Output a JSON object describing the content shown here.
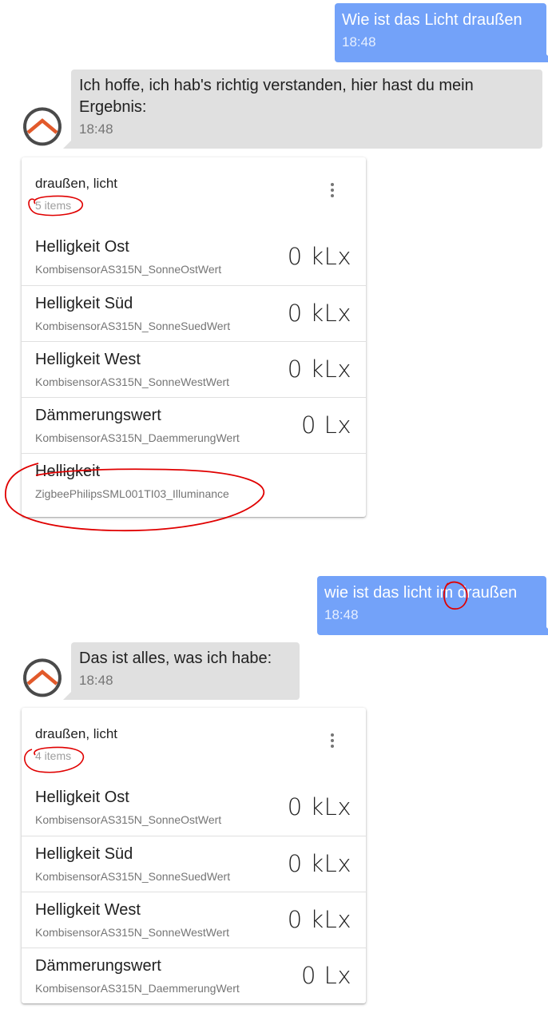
{
  "messages": [
    {
      "role": "user",
      "text": "Wie ist das Licht draußen",
      "time": "18:48"
    },
    {
      "role": "bot",
      "text": "Ich hoffe, ich hab's richtig verstanden, hier hast du mein Ergebnis:",
      "time": "18:48"
    },
    {
      "role": "user",
      "text": "wie ist das licht im draußen",
      "time": "18:48"
    },
    {
      "role": "bot",
      "text": "Das ist alles, was ich habe:",
      "time": "18:48"
    }
  ],
  "card1": {
    "title": "draußen, licht",
    "count": "5 items",
    "items": [
      {
        "label": "Helligkeit Ost",
        "item": "KombisensorAS315N_SonneOstWert",
        "value": "0 kLx"
      },
      {
        "label": "Helligkeit Süd",
        "item": "KombisensorAS315N_SonneSuedWert",
        "value": "0 kLx"
      },
      {
        "label": "Helligkeit West",
        "item": "KombisensorAS315N_SonneWestWert",
        "value": "0 kLx"
      },
      {
        "label": "Dämmerungswert",
        "item": "KombisensorAS315N_DaemmerungWert",
        "value": "0 Lx"
      },
      {
        "label": "Helligkeit",
        "item": "ZigbeePhilipsSML001TI03_Illuminance",
        "value": ""
      }
    ]
  },
  "card2": {
    "title": "draußen, licht",
    "count": "4 items",
    "items": [
      {
        "label": "Helligkeit Ost",
        "item": "KombisensorAS315N_SonneOstWert",
        "value": "0 kLx"
      },
      {
        "label": "Helligkeit Süd",
        "item": "KombisensorAS315N_SonneSuedWert",
        "value": "0 kLx"
      },
      {
        "label": "Helligkeit West",
        "item": "KombisensorAS315N_SonneWestWert",
        "value": "0 kLx"
      },
      {
        "label": "Dämmerungswert",
        "item": "KombisensorAS315N_DaemmerungWert",
        "value": "0 Lx"
      }
    ]
  },
  "colors": {
    "user_bubble": "#73a2f9",
    "bot_bubble": "#e0e0e0",
    "logo_dark": "#4a4a4a",
    "logo_accent": "#e25a2b",
    "annotation": "#e00000"
  },
  "icons": {
    "avatar": "openhab-logo-icon",
    "menu": "more-vert-icon"
  }
}
